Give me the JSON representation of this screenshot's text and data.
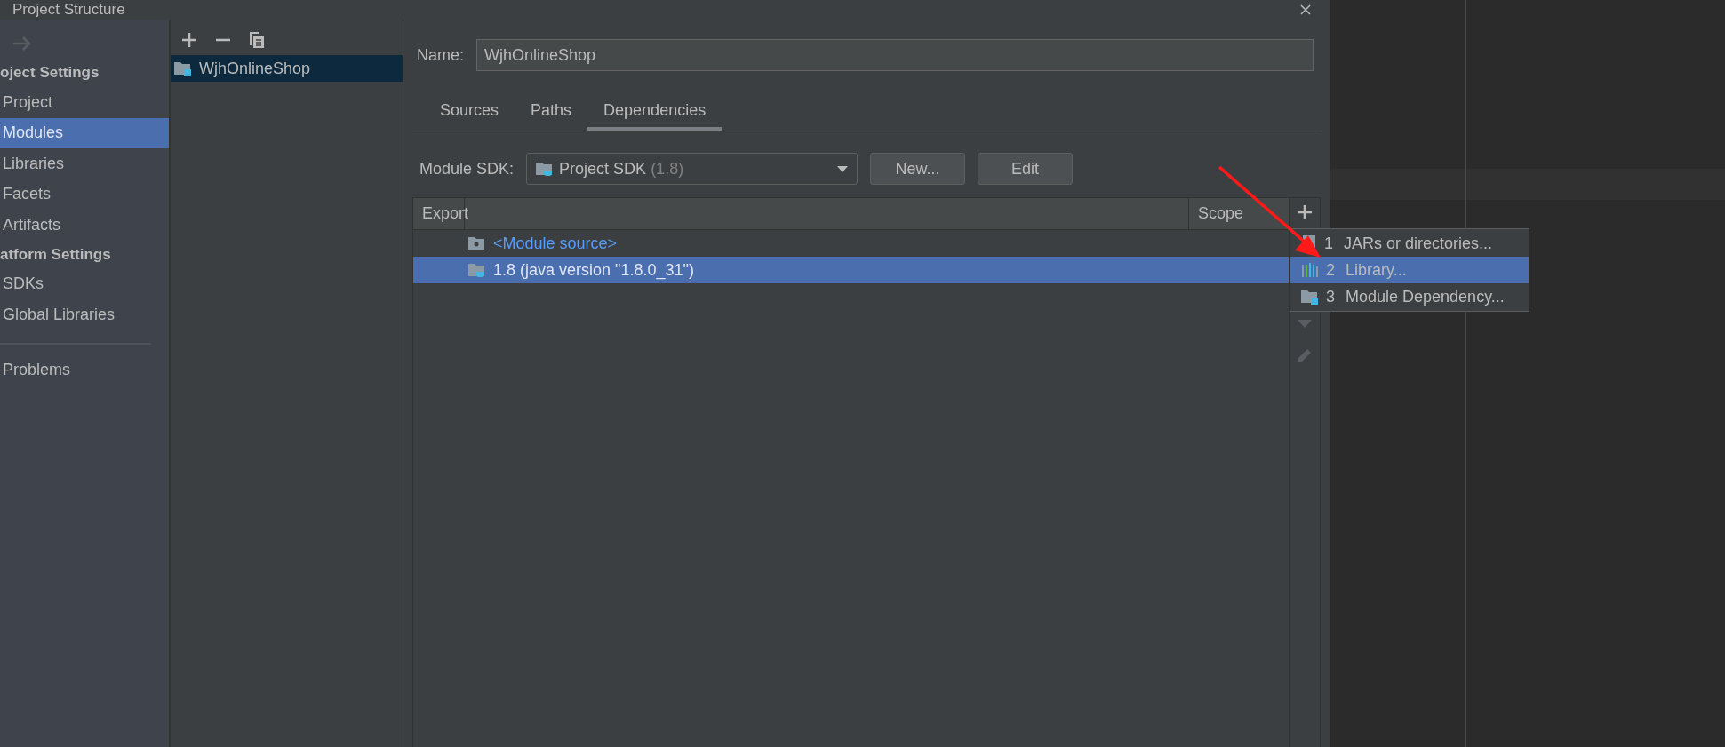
{
  "window": {
    "title": "Project Structure"
  },
  "sidebar": {
    "sections": [
      {
        "title": "oject Settings",
        "items": [
          {
            "label": "Project",
            "selected": false
          },
          {
            "label": "Modules",
            "selected": true
          },
          {
            "label": "Libraries",
            "selected": false
          },
          {
            "label": "Facets",
            "selected": false
          },
          {
            "label": "Artifacts",
            "selected": false
          }
        ]
      },
      {
        "title": "atform Settings",
        "items": [
          {
            "label": "SDKs",
            "selected": false
          },
          {
            "label": "Global Libraries",
            "selected": false
          }
        ]
      }
    ],
    "problems": {
      "label": "Problems",
      "selected": false
    }
  },
  "module_list": {
    "items": [
      {
        "label": "WjhOnlineShop",
        "selected": true
      }
    ]
  },
  "name_field": {
    "label": "Name:",
    "value": "WjhOnlineShop"
  },
  "tabs": [
    {
      "label": "Sources",
      "selected": false
    },
    {
      "label": "Paths",
      "selected": false
    },
    {
      "label": "Dependencies",
      "selected": true
    }
  ],
  "sdk": {
    "label": "Module SDK:",
    "value": "Project SDK",
    "version": "(1.8)",
    "buttons": [
      "New...",
      "Edit"
    ]
  },
  "table": {
    "columns": [
      "Export",
      "Scope"
    ],
    "rows": [
      {
        "kind": "source",
        "label": "<Module source>",
        "selected": false
      },
      {
        "kind": "sdk",
        "label": "1.8 (java version \"1.8.0_31\")",
        "selected": true
      }
    ]
  },
  "popup_menu": {
    "items": [
      {
        "kind": "jars",
        "number": "1",
        "label": "JARs or directories...",
        "selected": false
      },
      {
        "kind": "library",
        "number": "2",
        "label": "Library...",
        "selected": true
      },
      {
        "kind": "module",
        "number": "3",
        "label": "Module Dependency...",
        "selected": false
      }
    ]
  }
}
